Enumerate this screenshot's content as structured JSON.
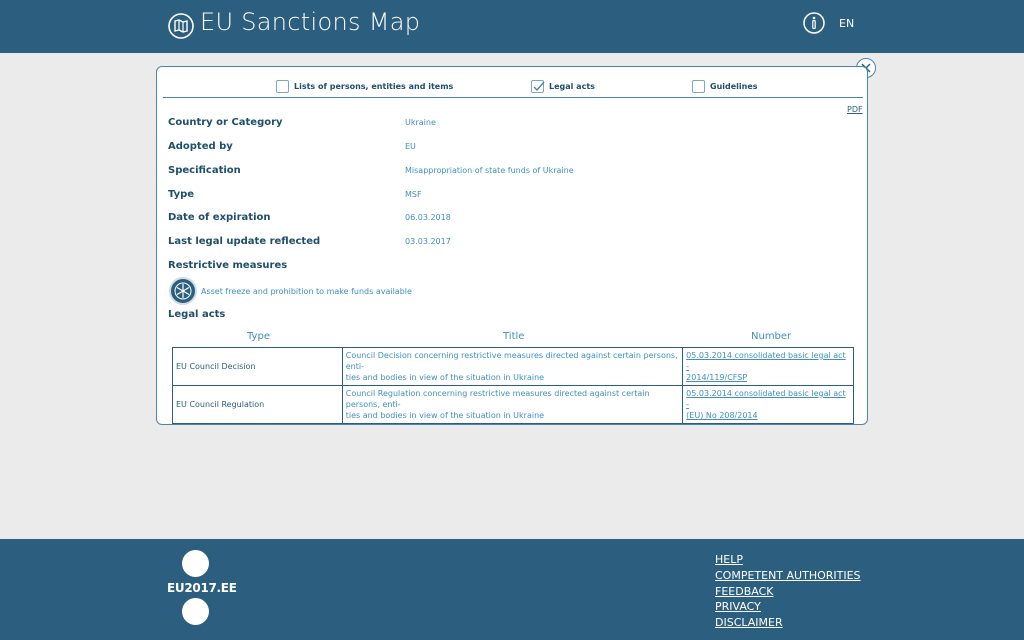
{
  "header": {
    "title": "EU Sanctions Map",
    "language": "EN"
  },
  "tabs": [
    {
      "label": "Lists of persons, entities and items",
      "checked": false
    },
    {
      "label": "Legal acts",
      "checked": true
    },
    {
      "label": "Guidelines",
      "checked": false
    }
  ],
  "pdf_label": "PDF",
  "details": [
    {
      "label": "Country or Category",
      "value": "Ukraine"
    },
    {
      "label": "Adopted by",
      "value": "EU"
    },
    {
      "label": "Specification",
      "value": "Misappropriation of state funds of Ukraine"
    },
    {
      "label": "Type",
      "value": "MSF"
    },
    {
      "label": "Date of expiration",
      "value": "06.03.2018"
    },
    {
      "label": "Last legal update reflected",
      "value": "03.03.2017"
    }
  ],
  "restrictive_measures": {
    "label": "Restrictive measures",
    "items": [
      {
        "icon": "snowflake-icon",
        "text": "Asset freeze and prohibition to make funds available"
      }
    ]
  },
  "legal_acts": {
    "label": "Legal acts",
    "columns": [
      "Type",
      "Title",
      "Number"
    ],
    "rows": [
      {
        "type": "EU Council Decision",
        "title_line1": "Council Decision concerning restrictive measures directed against certain persons, enti-",
        "title_line2": "ties and bodies in view of the situation in Ukraine",
        "number_line1": "05.03.2014 consolidated basic legal act -",
        "number_line2": "2014/119/CFSP"
      },
      {
        "type": "EU Council Regulation",
        "title_line1": "Council Regulation concerning restrictive measures directed against certain persons, enti-",
        "title_line2": "ties and bodies in view of the situation in Ukraine",
        "number_line1": "05.03.2014 consolidated basic legal act -",
        "number_line2": "(EU) No 208/2014"
      }
    ]
  },
  "footer": {
    "logo_text": "EU2017.EE",
    "links": [
      "HELP",
      "COMPETENT AUTHORITIES",
      "FEEDBACK",
      "PRIVACY",
      "DISCLAIMER"
    ]
  },
  "colors": {
    "header_bg": "#2c5f7f",
    "accent_text": "#3f8fbf",
    "panel_border": "#4a86a8"
  }
}
